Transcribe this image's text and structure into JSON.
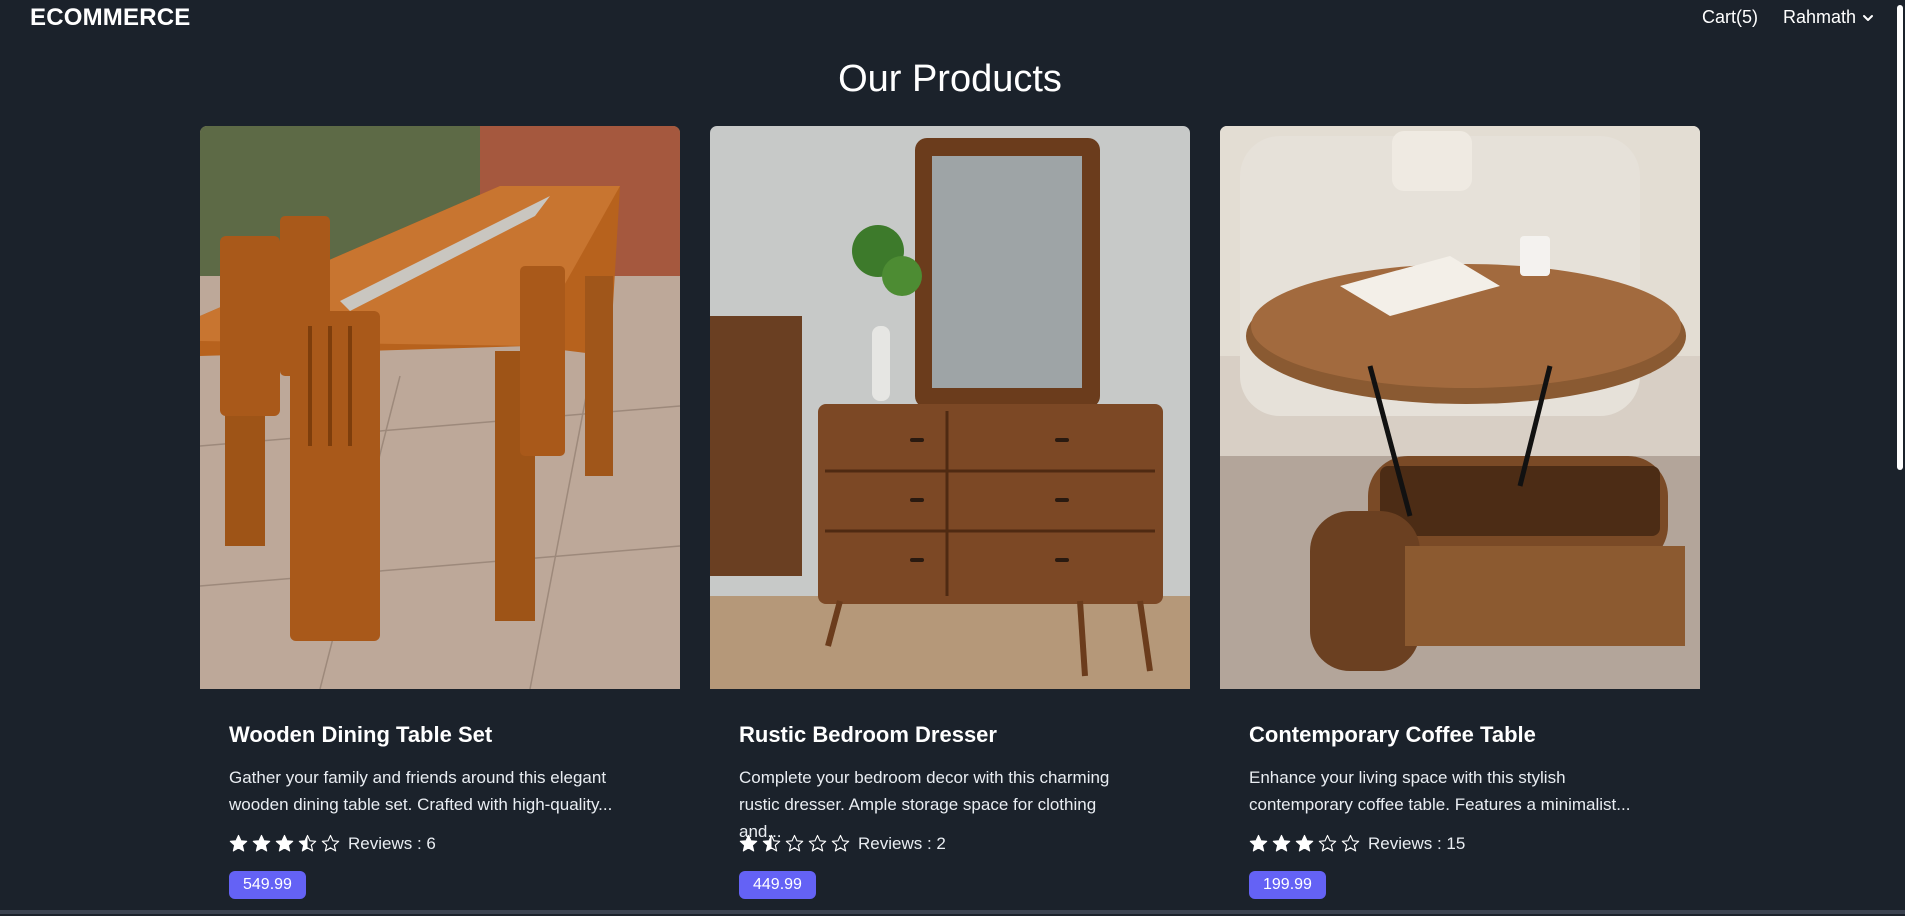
{
  "navbar": {
    "brand": "ECOMMERCE",
    "cart": "Cart(5)",
    "user": "Rahmath"
  },
  "page_title": "Our Products",
  "colors": {
    "background": "#1b222b",
    "price_badge": "#6462f5",
    "text": "#ffffff"
  },
  "products": [
    {
      "image": "wooden dining table with chairs",
      "title": "Wooden Dining Table Set",
      "desc_line1": "Gather your family and friends around this elegant",
      "desc_line2": "wooden dining table set. Crafted with high-quality...",
      "rating": 3.5,
      "reviews": "Reviews : 6",
      "price": "549.99"
    },
    {
      "image": "rustic wooden dresser with mirror",
      "title": "Rustic Bedroom Dresser",
      "desc_line1": "Complete your bedroom decor with this charming",
      "desc_line2": "rustic dresser. Ample storage space for clothing and...",
      "rating": 1.5,
      "reviews": "Reviews : 2",
      "price": "449.99"
    },
    {
      "image": "lift-top wooden coffee table",
      "title": "Contemporary Coffee Table",
      "desc_line1": "Enhance your living space with this stylish",
      "desc_line2": "contemporary coffee table. Features a minimalist...",
      "rating": 3,
      "reviews": "Reviews : 15",
      "price": "199.99"
    }
  ]
}
